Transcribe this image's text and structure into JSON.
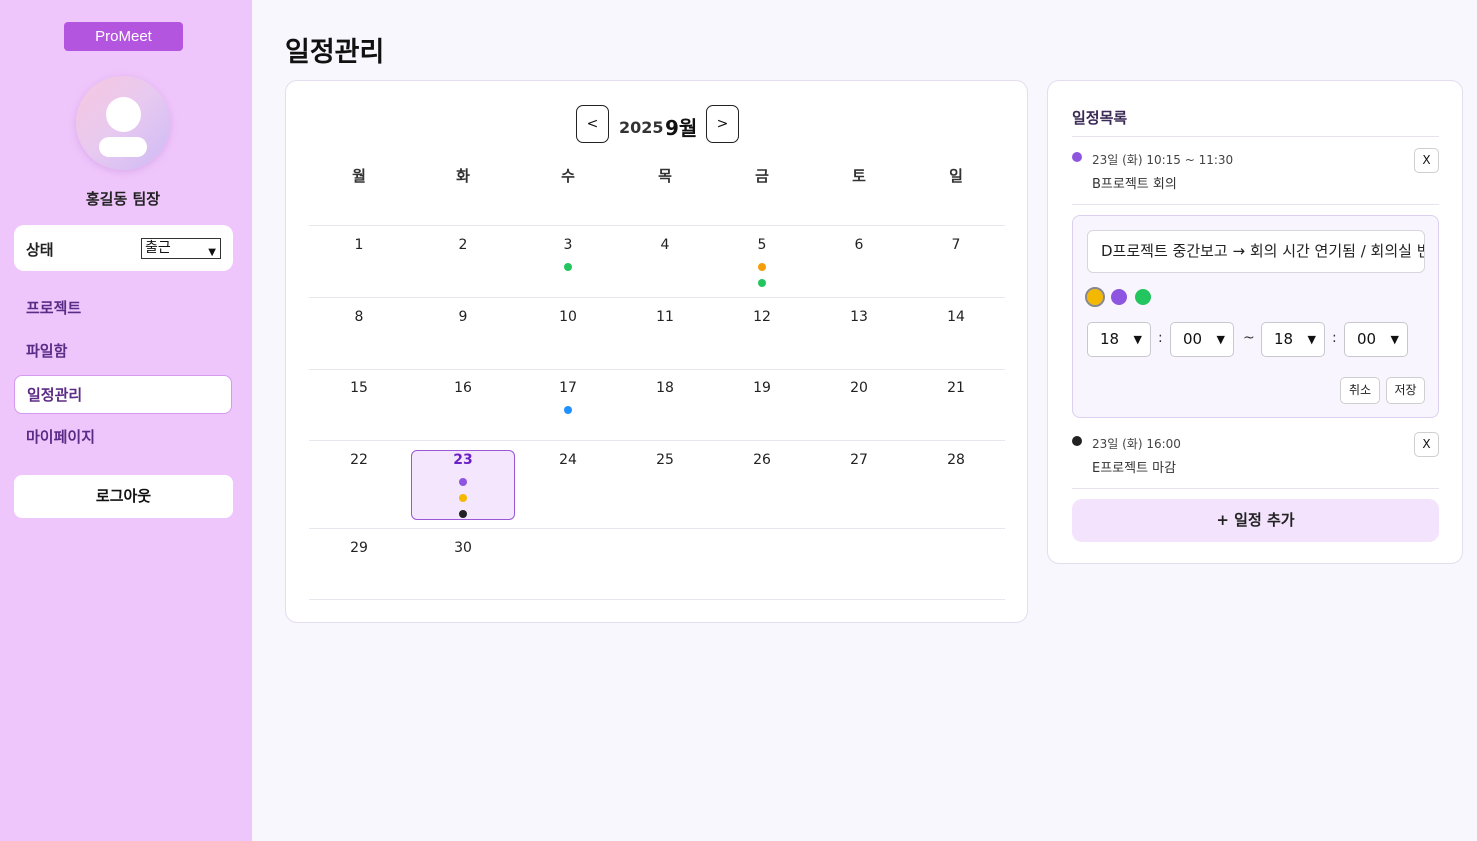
{
  "app": {
    "logo": "ProMeet"
  },
  "user": {
    "name": "홍길동 팀장"
  },
  "status": {
    "label": "상태",
    "value": "출근"
  },
  "sidebar": {
    "items": [
      {
        "label": "프로젝트"
      },
      {
        "label": "파일함"
      },
      {
        "label": "일정관리"
      },
      {
        "label": "마이페이지"
      }
    ],
    "logout": "로그아웃"
  },
  "page": {
    "title": "일정관리"
  },
  "calendar": {
    "prev": "<",
    "next": ">",
    "year": "2025",
    "month": "9월",
    "weekdays": [
      "월",
      "화",
      "수",
      "목",
      "금",
      "토",
      "일"
    ],
    "weeks": [
      [
        "1",
        "2",
        "3",
        "4",
        "5",
        "6",
        "7"
      ],
      [
        "8",
        "9",
        "10",
        "11",
        "12",
        "13",
        "14"
      ],
      [
        "15",
        "16",
        "17",
        "18",
        "19",
        "20",
        "21"
      ],
      [
        "22",
        "23",
        "24",
        "25",
        "26",
        "27",
        "28"
      ],
      [
        "29",
        "30",
        "",
        "",
        "",
        "",
        ""
      ]
    ],
    "today": "23",
    "event_dots": {
      "3": [
        "#22c55e"
      ],
      "5": [
        "#f59e0b",
        "#22c55e"
      ],
      "17": [
        "#1e90ff"
      ],
      "23": [
        "#8e56e0",
        "#f5b800",
        "#222222"
      ]
    }
  },
  "schedule": {
    "title": "일정목록",
    "events": [
      {
        "color": "#8e56e0",
        "time": "23일 (화) 10:15 ~ 11:30",
        "title": "B프로젝트 회의",
        "delete": "X"
      },
      {
        "color": "#222222",
        "time": "23일 (화) 16:00",
        "title": "E프로젝트 마감",
        "delete": "X"
      }
    ],
    "editor": {
      "input_value": "D프로젝트 중간보고 → 회의 시간 연기됨 / 회의실 변경",
      "colors": [
        "#f5b800",
        "#8e56e0",
        "#22c55e"
      ],
      "start_hour": "18",
      "start_minute": "00",
      "end_hour": "18",
      "end_minute": "00",
      "colon": ":",
      "tilde": "~",
      "cancel": "취소",
      "save": "저장"
    },
    "add_button": "+ 일정 추가"
  }
}
